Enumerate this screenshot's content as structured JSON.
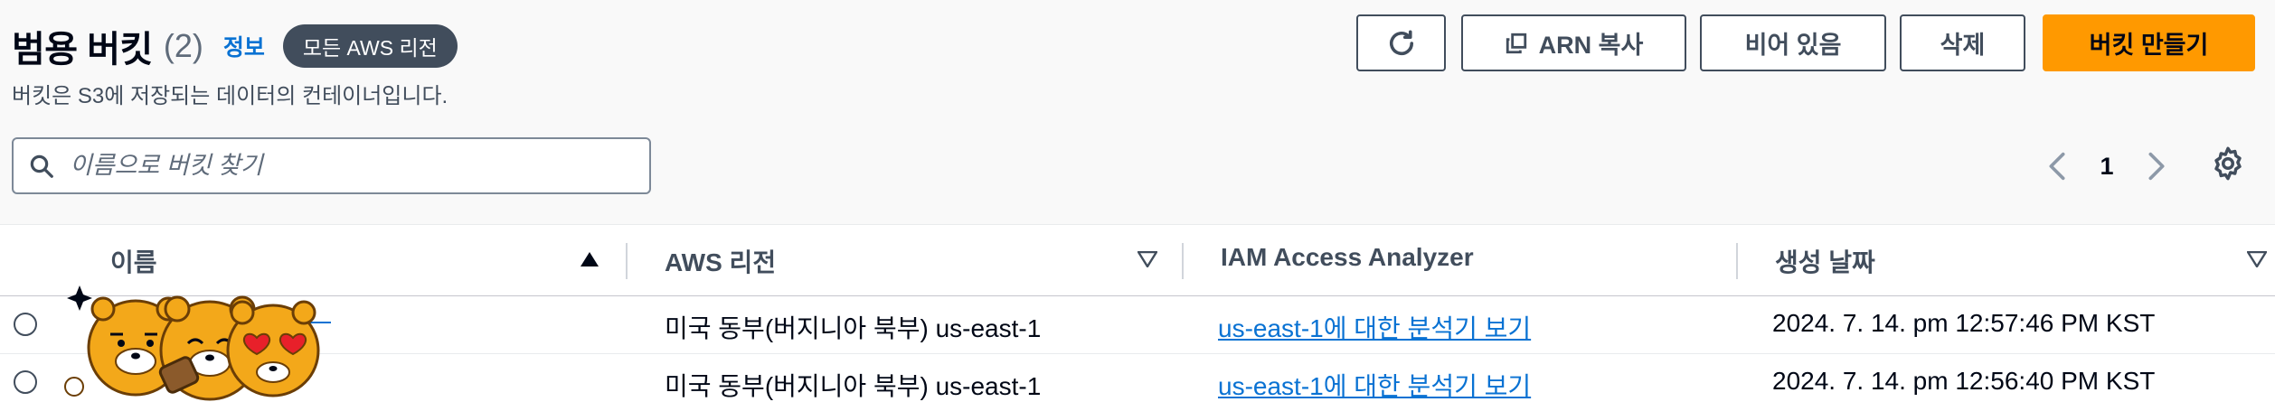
{
  "header": {
    "title": "범용 버킷",
    "count": "(2)",
    "info_link": "정보",
    "region_badge": "모든 AWS 리전",
    "subtitle": "버킷은 S3에 저장되는 데이터의 컨테이너입니다."
  },
  "toolbar": {
    "refresh_icon": "refresh-icon",
    "copy_arn_label": "ARN 복사",
    "empty_label": "비어 있음",
    "delete_label": "삭제",
    "create_label": "버킷 만들기",
    "create_color": "#ff9900"
  },
  "search": {
    "placeholder": "이름으로 버킷 찾기",
    "value": ""
  },
  "pagination": {
    "current_page": "1"
  },
  "table": {
    "columns": [
      "이름",
      "AWS 리전",
      "IAM Access Analyzer",
      "생성 날짜"
    ],
    "rows": [
      {
        "name": "",
        "region": "미국 동부(버지니아 북부) us-east-1",
        "analyzer": "us-east-1에 대한 분석기 보기",
        "created": "2024. 7. 14. pm 12:57:46 PM KST"
      },
      {
        "name": "",
        "region": "미국 동부(버지니아 북부) us-east-1",
        "analyzer": "us-east-1에 대한 분석기 보기",
        "created": "2024. 7. 14. pm 12:56:40 PM KST"
      }
    ]
  },
  "colors": {
    "link": "#0972d3",
    "text": "#000716",
    "border": "#414d5c",
    "badge_bg": "#414d5c"
  }
}
